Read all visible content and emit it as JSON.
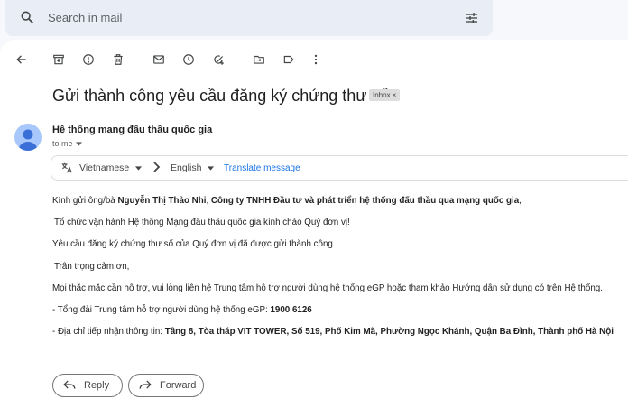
{
  "search": {
    "placeholder": "Search in mail"
  },
  "toolbar": {
    "back": "arrow-back-icon",
    "archive": "archive-icon",
    "report": "report-spam-icon",
    "delete": "trash-icon",
    "mark_unread": "mail-icon",
    "snooze": "clock-icon",
    "add_task": "add-task-icon",
    "move": "move-to-icon",
    "label": "label-icon",
    "more": "more-vert-icon"
  },
  "email": {
    "subject": "Gửi thành công yêu cầu đăng ký chứng thư số",
    "label": "Inbox",
    "sender": "Hệ thống mạng đấu thầu quốc gia",
    "to": "to me"
  },
  "translate": {
    "source_lang": "Vietnamese",
    "target_lang": "English",
    "action": "Translate message"
  },
  "body": {
    "greeting_prefix": "Kính gửi ông/bà ",
    "greeting_name": "Nguyễn Thị Thảo Nhi",
    "greeting_sep": ", ",
    "greeting_company": "Công ty TNHH Đầu tư và phát triển hệ thống đấu thầu qua mạng quốc gia",
    "greeting_suffix": ",",
    "line2": "Tổ chức vận hành Hệ thống Mạng đấu thầu quốc gia kính chào Quý đơn vị!",
    "line3": "Yêu cầu đăng ký chứng thư số của Quý đơn vị đã được gửi thành công",
    "line4": "Trân trọng cảm ơn,",
    "line5": "Mọi thắc mắc cần hỗ trợ, vui lòng liên hệ Trung tâm hỗ trợ người dùng hệ thống eGP hoặc tham khảo Hướng dẫn sử dụng có trên Hệ thống.",
    "hotline_prefix": "- Tổng đài Trung tâm hỗ trợ người dùng hệ thống eGP: ",
    "hotline_number": "1900 6126",
    "address_prefix": "- Địa chỉ tiếp nhận thông tin: ",
    "address_value": "Tầng 8, Tòa tháp VIT TOWER, Số 519, Phố Kim Mã, Phường Ngọc Khánh, Quận Ba Đình, Thành phố Hà Nội"
  },
  "actions": {
    "reply": "Reply",
    "forward": "Forward"
  }
}
